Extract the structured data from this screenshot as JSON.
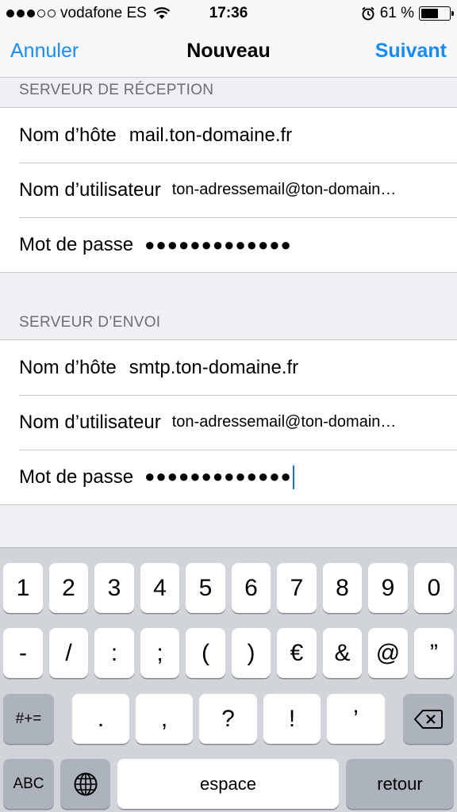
{
  "status_bar": {
    "carrier": "vodafone ES",
    "signal_bars_filled": 3,
    "signal_bars_total": 5,
    "time": "17:36",
    "alarm_icon": "alarm-icon",
    "battery_text": "61 %",
    "battery_level": 0.61
  },
  "nav": {
    "cancel_label": "Annuler",
    "title": "Nouveau",
    "next_label": "Suivant",
    "accent_color": "#1a8cf0"
  },
  "incoming": {
    "header": "SERVEUR DE RÉCEPTION",
    "host_label": "Nom d’hôte",
    "host_value": "mail.ton-domaine.fr",
    "user_label": "Nom d’utilisateur",
    "user_value": "ton-adressemail@ton-domain…",
    "password_label": "Mot de passe",
    "password_value": "●●●●●●●●●●●●●"
  },
  "outgoing": {
    "header": "SERVEUR D’ENVOI",
    "host_label": "Nom d’hôte",
    "host_value": "smtp.ton-domaine.fr",
    "user_label": "Nom d’utilisateur",
    "user_value": "ton-adressemail@ton-domain…",
    "password_label": "Mot de passe",
    "password_value": "●●●●●●●●●●●●●"
  },
  "keyboard": {
    "row1": [
      "1",
      "2",
      "3",
      "4",
      "5",
      "6",
      "7",
      "8",
      "9",
      "0"
    ],
    "row2": [
      "-",
      "/",
      ":",
      ";",
      "(",
      ")",
      "€",
      "&",
      "@",
      "”"
    ],
    "symbols_label": "#+=",
    "row3": [
      ".",
      ",",
      "?",
      "!",
      "’"
    ],
    "delete_icon": "backspace-icon",
    "abc_label": "ABC",
    "globe_icon": "globe-icon",
    "space_label": "espace",
    "return_label": "retour"
  }
}
